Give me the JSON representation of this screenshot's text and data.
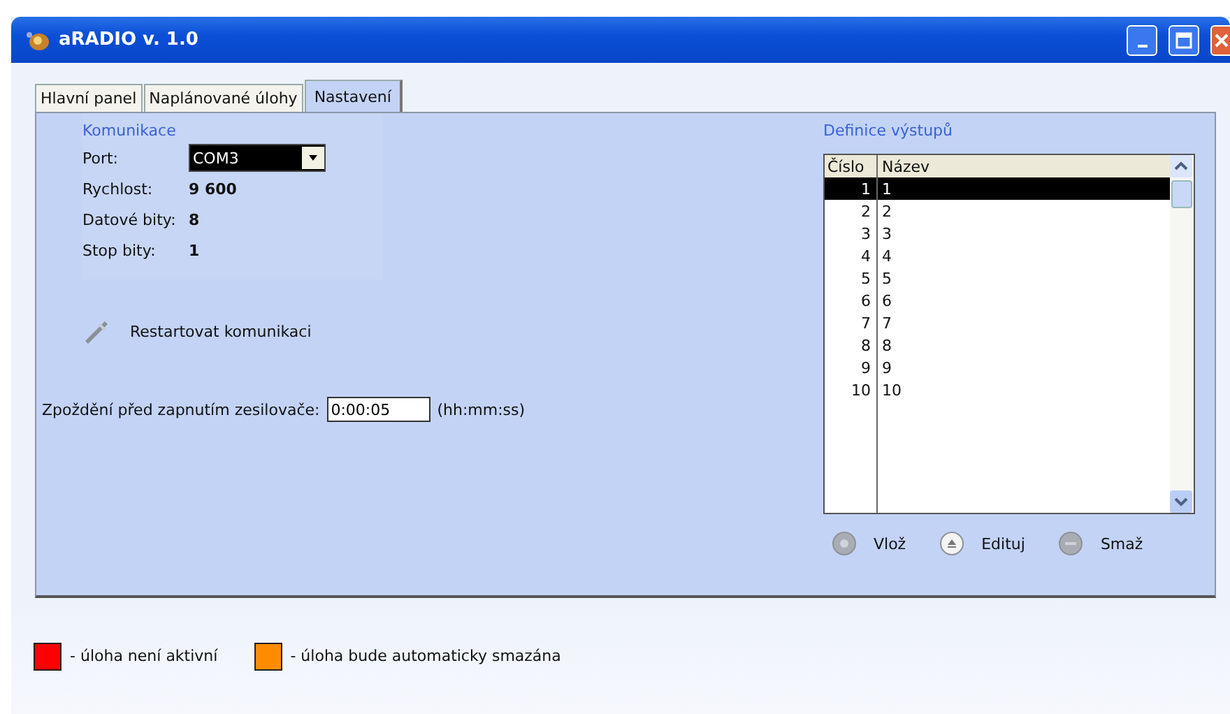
{
  "window": {
    "title": "aRADIO v. 1.0"
  },
  "tabs": [
    {
      "label": "Hlavní panel",
      "selected": false
    },
    {
      "label": "Naplánované úlohy",
      "selected": false
    },
    {
      "label": "Nastavení",
      "selected": true
    }
  ],
  "communication": {
    "title": "Komunikace",
    "port": {
      "label": "Port:",
      "value": "COM3"
    },
    "fields": [
      {
        "label": "Rychlost:",
        "value": "9 600"
      },
      {
        "label": "Datové bity:",
        "value": "8"
      },
      {
        "label": "Stop bity:",
        "value": "1"
      }
    ]
  },
  "restart_button": "Restartovat komunikaci",
  "delay": {
    "label": "Zpoždění před zapnutím zesilovače:",
    "value": "0:00:05",
    "unit": "(hh:mm:ss)"
  },
  "outputs": {
    "title": "Definice výstupů",
    "columns": [
      "Číslo",
      "Název"
    ],
    "rows": [
      {
        "number": "1",
        "name": "1",
        "selected": true
      },
      {
        "number": "2",
        "name": "2",
        "selected": false
      },
      {
        "number": "3",
        "name": "3",
        "selected": false
      },
      {
        "number": "4",
        "name": "4",
        "selected": false
      },
      {
        "number": "5",
        "name": "5",
        "selected": false
      },
      {
        "number": "6",
        "name": "6",
        "selected": false
      },
      {
        "number": "7",
        "name": "7",
        "selected": false
      },
      {
        "number": "8",
        "name": "8",
        "selected": false
      },
      {
        "number": "9",
        "name": "9",
        "selected": false
      },
      {
        "number": "10",
        "name": "10",
        "selected": false
      }
    ],
    "buttons": [
      {
        "label": "Vlož",
        "kind": "add"
      },
      {
        "label": "Edituj",
        "kind": "edit"
      },
      {
        "label": "Smaž",
        "kind": "delete"
      }
    ]
  },
  "legend": [
    {
      "label": "- úloha není aktivní",
      "color": "#ff0000"
    },
    {
      "label": "- úloha bude automaticky smazána",
      "color": "#ff8c00"
    }
  ]
}
